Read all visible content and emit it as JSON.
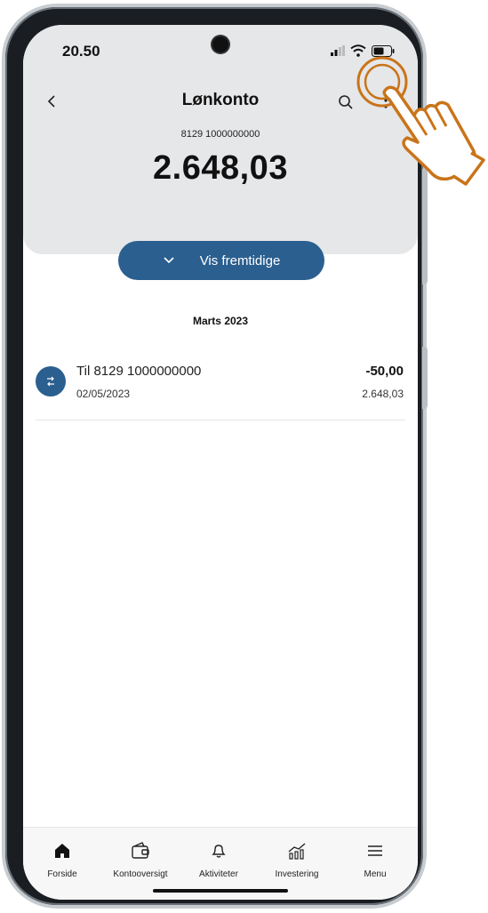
{
  "status": {
    "time": "20.50"
  },
  "header": {
    "title": "Lønkonto",
    "account_number": "8129 1000000000",
    "balance": "2.648,03"
  },
  "actions": {
    "future_label": "Vis fremtidige"
  },
  "month_label": "Marts 2023",
  "transactions": [
    {
      "title": "Til 8129 1000000000",
      "date": "02/05/2023",
      "amount": "-50,00",
      "balance_after": "2.648,03"
    }
  ],
  "nav": [
    {
      "label": "Forside",
      "icon": "home-icon"
    },
    {
      "label": "Kontooversigt",
      "icon": "wallet-icon"
    },
    {
      "label": "Aktiviteter",
      "icon": "bell-icon"
    },
    {
      "label": "Investering",
      "icon": "chart-icon"
    },
    {
      "label": "Menu",
      "icon": "menu-icon"
    }
  ],
  "colors": {
    "accent": "#2b5f8f",
    "header_bg": "#e6e7e9",
    "hand": "#c9741a"
  }
}
